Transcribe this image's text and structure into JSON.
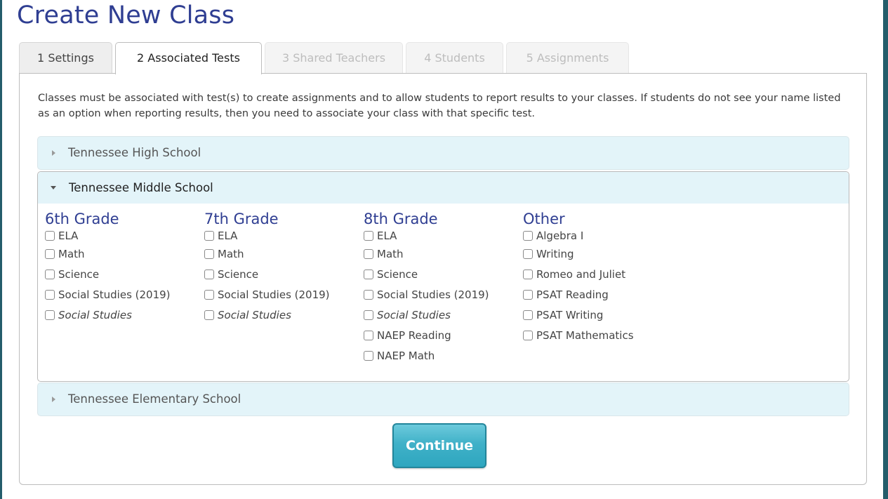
{
  "page": {
    "title": "Create New Class"
  },
  "tabs": [
    {
      "label": "1 Settings",
      "state": "enabled"
    },
    {
      "label": "2 Associated Tests",
      "state": "active"
    },
    {
      "label": "3 Shared Teachers",
      "state": "disabled"
    },
    {
      "label": "4 Students",
      "state": "disabled"
    },
    {
      "label": "5 Assignments",
      "state": "disabled"
    }
  ],
  "intro_text": "Classes must be associated with test(s) to create assignments and to allow students to report results to your classes. If students do not see your name listed as an option when reporting results, then you need to associate your class with that specific test.",
  "accordions": {
    "high": {
      "label": "Tennessee High School",
      "expanded": false
    },
    "middle": {
      "label": "Tennessee Middle School",
      "expanded": true,
      "groups": [
        {
          "title": "6th Grade",
          "options": [
            {
              "label": "ELA",
              "checked": false,
              "italic": false
            },
            {
              "label": "Math",
              "checked": false,
              "italic": false
            },
            {
              "label": "Science",
              "checked": false,
              "italic": false
            },
            {
              "label": "Social Studies (2019)",
              "checked": false,
              "italic": false
            },
            {
              "label": "Social Studies",
              "checked": false,
              "italic": true
            }
          ]
        },
        {
          "title": "7th Grade",
          "options": [
            {
              "label": "ELA",
              "checked": false,
              "italic": false
            },
            {
              "label": "Math",
              "checked": false,
              "italic": false
            },
            {
              "label": "Science",
              "checked": false,
              "italic": false
            },
            {
              "label": "Social Studies (2019)",
              "checked": false,
              "italic": false
            },
            {
              "label": "Social Studies",
              "checked": false,
              "italic": true
            }
          ]
        },
        {
          "title": "8th Grade",
          "options": [
            {
              "label": "ELA",
              "checked": false,
              "italic": false
            },
            {
              "label": "Math",
              "checked": false,
              "italic": false
            },
            {
              "label": "Science",
              "checked": false,
              "italic": false
            },
            {
              "label": "Social Studies (2019)",
              "checked": false,
              "italic": false
            },
            {
              "label": "Social Studies",
              "checked": false,
              "italic": true
            },
            {
              "label": "NAEP Reading",
              "checked": false,
              "italic": false
            },
            {
              "label": "NAEP Math",
              "checked": false,
              "italic": false
            }
          ]
        },
        {
          "title": "Other",
          "options": [
            {
              "label": "Algebra I",
              "checked": false,
              "italic": false
            },
            {
              "label": "Writing",
              "checked": false,
              "italic": false
            },
            {
              "label": "Romeo and Juliet",
              "checked": false,
              "italic": false
            },
            {
              "label": "PSAT Reading",
              "checked": false,
              "italic": false
            },
            {
              "label": "PSAT Writing",
              "checked": false,
              "italic": false
            },
            {
              "label": "PSAT Mathematics",
              "checked": false,
              "italic": false
            }
          ]
        }
      ]
    },
    "elementary": {
      "label": "Tennessee Elementary School",
      "expanded": false
    }
  },
  "continue_button": {
    "label": "Continue"
  },
  "colors": {
    "title": "#2f3e92",
    "accordion_bg": "#e3f4f9",
    "button": "#40b1c8",
    "frame": "#245d6b"
  }
}
